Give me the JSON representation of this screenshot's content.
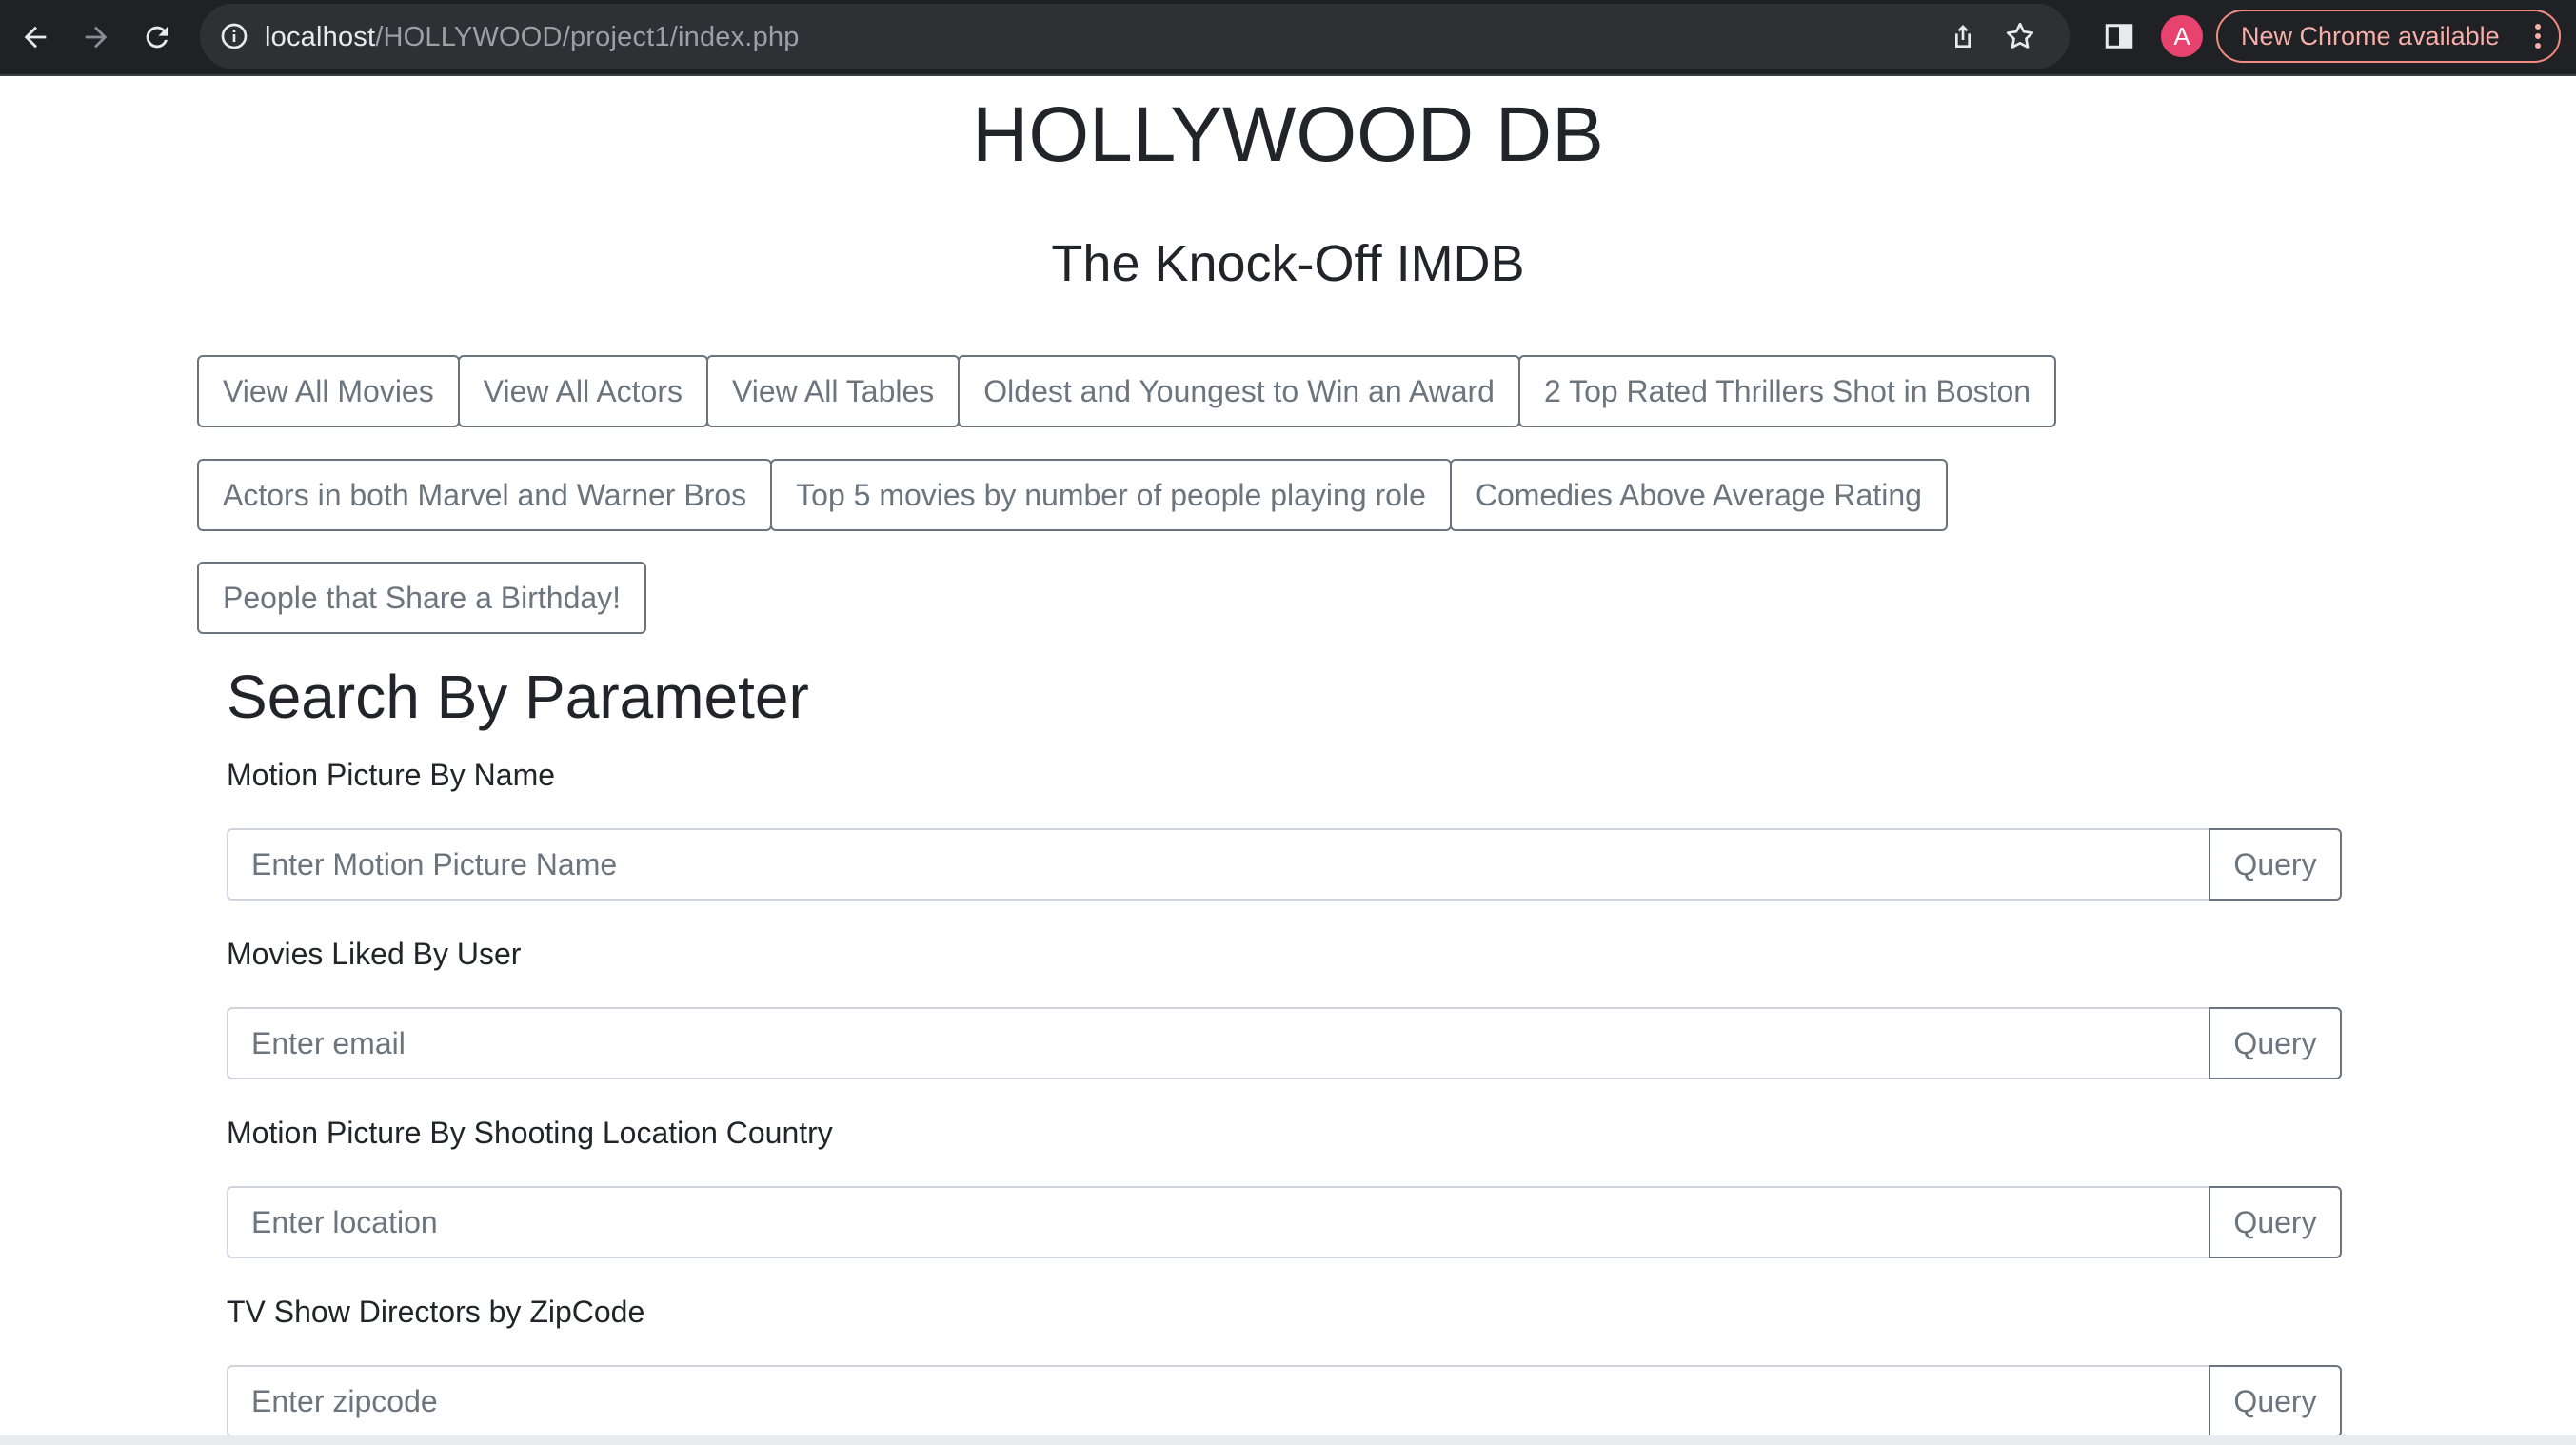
{
  "browser": {
    "url_host": "localhost",
    "url_path": "/HOLLYWOOD/project1/index.php",
    "avatar_letter": "A",
    "update_label": "New Chrome available",
    "icons": [
      "back-arrow-icon",
      "forward-arrow-icon",
      "reload-icon",
      "info-icon",
      "share-icon",
      "star-icon",
      "side-panel-icon",
      "more-vert-icon"
    ]
  },
  "header": {
    "title": "HOLLYWOOD DB",
    "subtitle": "The Knock-Off IMDB"
  },
  "buttons": {
    "row1": [
      "View All Movies",
      "View All Actors",
      "View All Tables",
      "Oldest and Youngest to Win an Award",
      "2 Top Rated Thrillers Shot in Boston"
    ],
    "row2": [
      "Actors in both Marvel and Warner Bros",
      "Top 5 movies by number of people playing role",
      "Comedies Above Average Rating"
    ],
    "row3": [
      "People that Share a Birthday!"
    ]
  },
  "search": {
    "title": "Search By Parameter",
    "fields": [
      {
        "label": "Motion Picture By Name",
        "placeholder": "Enter Motion Picture Name",
        "button": "Query"
      },
      {
        "label": "Movies Liked By User",
        "placeholder": "Enter email",
        "button": "Query"
      },
      {
        "label": "Motion Picture By Shooting Location Country",
        "placeholder": "Enter location",
        "button": "Query"
      },
      {
        "label": "TV Show Directors by ZipCode",
        "placeholder": "Enter zipcode",
        "button": "Query"
      }
    ]
  },
  "colors": {
    "chrome_bg": "#202124",
    "omnibox_bg": "#2f3033",
    "avatar_bg": "#e8436f",
    "update_accent": "#f28b82",
    "button_border": "#6c757d",
    "text": "#212529"
  }
}
